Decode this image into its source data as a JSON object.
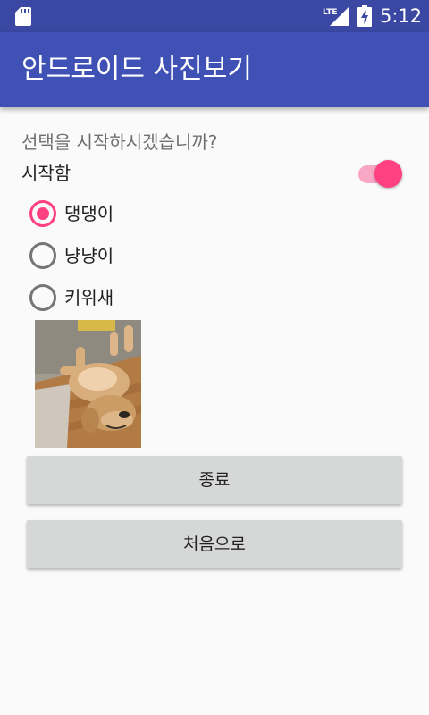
{
  "status_bar": {
    "time": "5:12",
    "network_label": "LTE",
    "icons": [
      "sd-card-icon",
      "lte-signal-icon",
      "battery-charging-icon"
    ]
  },
  "app_bar": {
    "title": "안드로이드 사진보기",
    "color": "#3f51b5"
  },
  "main": {
    "question": "선택을 시작하시겠습니까?",
    "start_switch": {
      "label": "시작함",
      "checked": true
    },
    "options": [
      {
        "label": "댕댕이",
        "checked": true
      },
      {
        "label": "냥냥이",
        "checked": false
      },
      {
        "label": "키위새",
        "checked": false
      }
    ],
    "photo": {
      "subject": "dog-photo"
    },
    "buttons": {
      "exit_label": "종료",
      "restart_label": "처음으로"
    }
  },
  "colors": {
    "status_bar": "#3a47a3",
    "accent": "#ff4081",
    "background": "#fafafa",
    "button": "#d6d7d7"
  }
}
